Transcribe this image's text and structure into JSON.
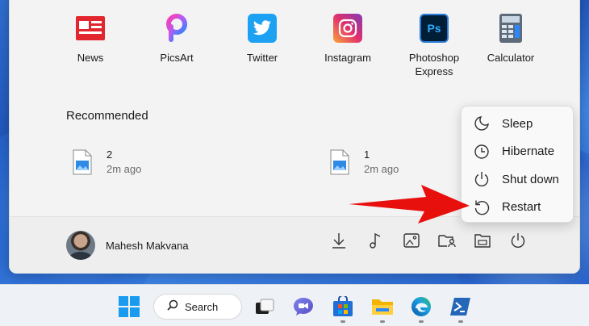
{
  "pinned_apps": [
    {
      "label": "News",
      "icon": "news-icon"
    },
    {
      "label": "PicsArt",
      "icon": "picsart-icon"
    },
    {
      "label": "Twitter",
      "icon": "twitter-icon"
    },
    {
      "label": "Instagram",
      "icon": "instagram-icon"
    },
    {
      "label": "Photoshop Express",
      "icon": "photoshop-express-icon",
      "icon_text": "Ps"
    },
    {
      "label": "Calculator",
      "icon": "calculator-icon"
    }
  ],
  "recommended": {
    "title": "Recommended",
    "items": [
      {
        "name": "2",
        "time": "2m ago",
        "icon": "image-file-icon"
      },
      {
        "name": "1",
        "time": "2m ago",
        "icon": "image-file-icon"
      }
    ]
  },
  "user": {
    "name": "Mahesh Makvana"
  },
  "footer_icons": [
    "downloads-icon",
    "music-icon",
    "pictures-icon",
    "user-folder-icon",
    "file-explorer-icon",
    "power-icon"
  ],
  "power_menu": {
    "items": [
      {
        "label": "Sleep",
        "icon": "moon-icon"
      },
      {
        "label": "Hibernate",
        "icon": "clock-icon"
      },
      {
        "label": "Shut down",
        "icon": "power-icon"
      },
      {
        "label": "Restart",
        "icon": "restart-icon"
      }
    ]
  },
  "taskbar": {
    "search_label": "Search",
    "items": [
      "start-icon",
      "task-view-icon",
      "teams-chat-icon",
      "store-icon",
      "file-explorer-icon",
      "edge-icon",
      "powershell-icon"
    ]
  },
  "colors": {
    "arrow": "#e8100d",
    "accent": "#0067c0"
  }
}
